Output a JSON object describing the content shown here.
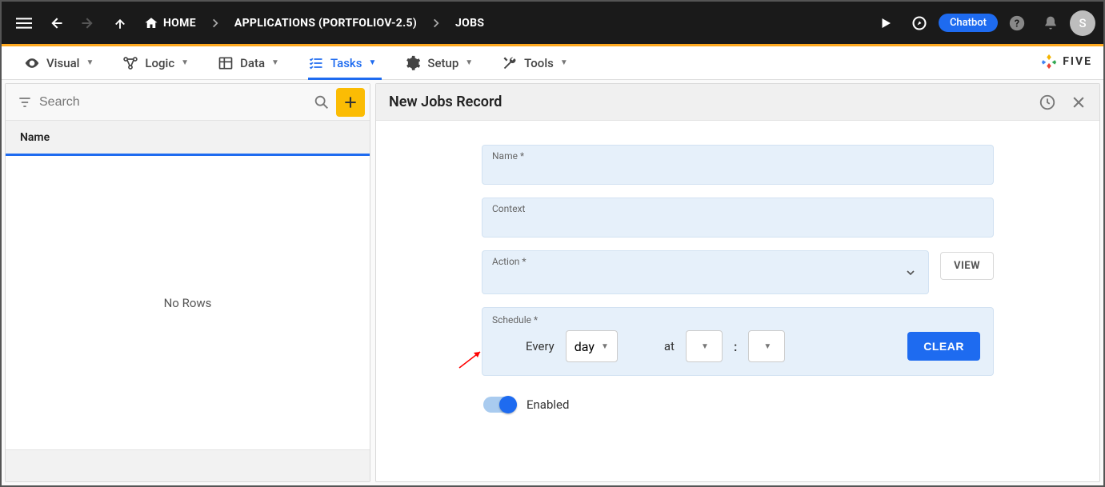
{
  "topbar": {
    "home": "HOME",
    "breadcrumb_app": "APPLICATIONS (PORTFOLIOV-2.5)",
    "breadcrumb_page": "JOBS",
    "chatbot": "Chatbot",
    "avatar_initial": "S"
  },
  "tabs": {
    "visual": "Visual",
    "logic": "Logic",
    "data": "Data",
    "tasks": "Tasks",
    "setup": "Setup",
    "tools": "Tools",
    "brand": "FIVE"
  },
  "left": {
    "search_placeholder": "Search",
    "column_name": "Name",
    "empty": "No Rows"
  },
  "detail": {
    "title": "New Jobs Record",
    "fields": {
      "name_label": "Name *",
      "context_label": "Context",
      "action_label": "Action *",
      "view_button": "VIEW",
      "schedule_label": "Schedule *",
      "every": "Every",
      "unit": "day",
      "at": "at",
      "hour": "",
      "minute": "",
      "clear": "CLEAR",
      "enabled_label": "Enabled",
      "enabled_value": true
    }
  },
  "icons": {
    "menu": "menu-icon",
    "back": "back-icon",
    "forward": "forward-icon",
    "up": "up-icon",
    "home": "home-icon",
    "chevron_right": "chevron-right-icon",
    "play": "play-icon",
    "discover": "discover-icon",
    "help": "help-icon",
    "bell": "bell-icon",
    "eye": "eye-icon",
    "graph": "graph-icon",
    "grid": "grid-icon",
    "checklist": "checklist-icon",
    "gear": "gear-icon",
    "wrench": "wrench-icon",
    "filter": "filter-icon",
    "search": "search-icon",
    "plus": "plus-icon",
    "clock": "clock-icon",
    "close": "close-icon",
    "dropdown": "chevron-down-icon"
  },
  "colors": {
    "accent_blue": "#1e6bf0",
    "accent_orange": "#ffa91f",
    "accent_yellow": "#fbbc04",
    "field_bg": "#e6f0fa"
  }
}
